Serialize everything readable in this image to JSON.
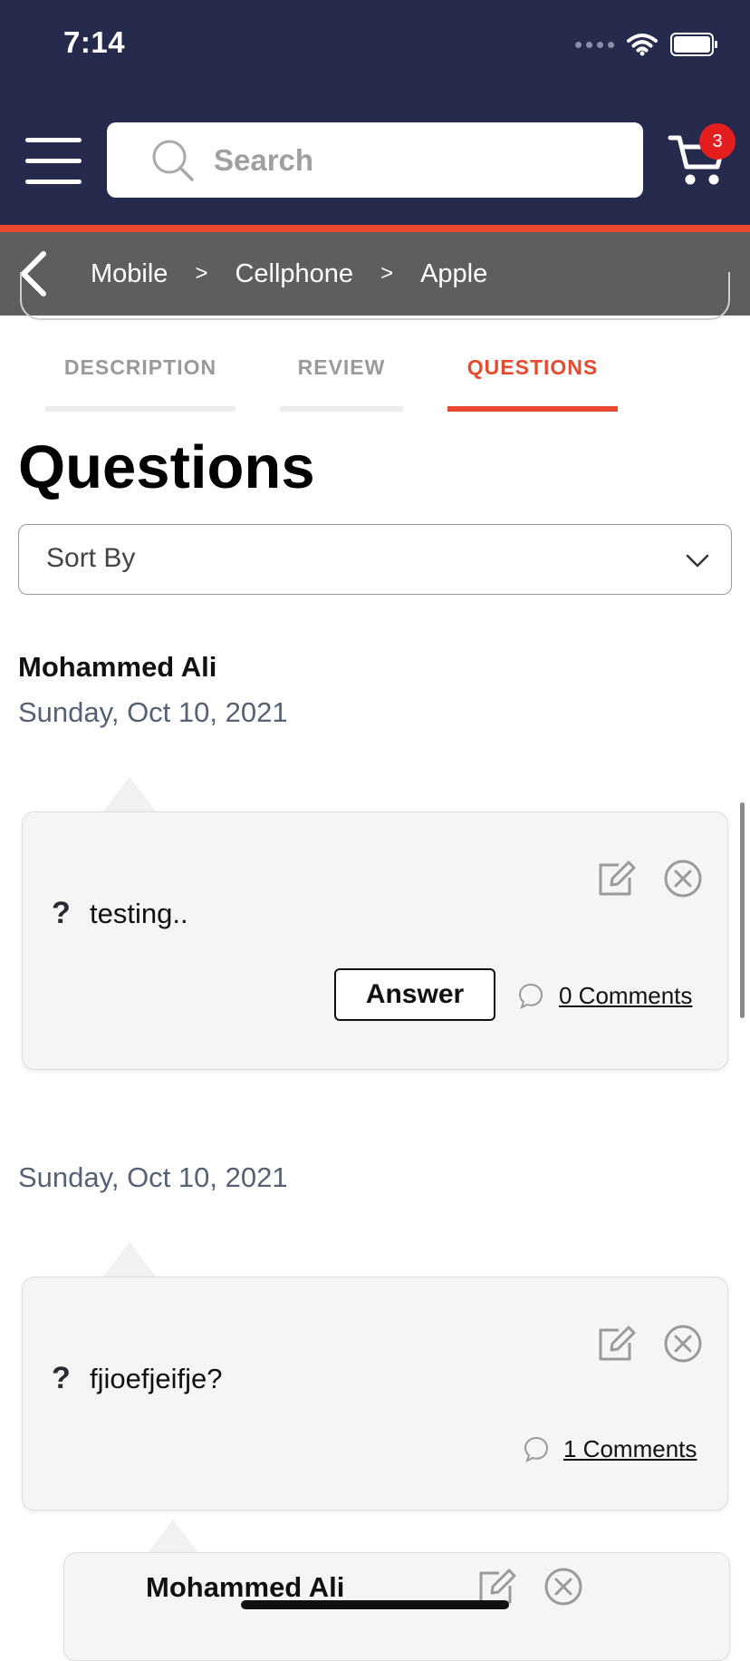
{
  "status": {
    "time": "7:14"
  },
  "header": {
    "search_placeholder": "Search",
    "cart_count": "3"
  },
  "breadcrumb": [
    "Mobile",
    "Cellphone",
    "Apple"
  ],
  "breadcrumb_separator": ">",
  "tabs": [
    {
      "label": "DESCRIPTION",
      "active": false
    },
    {
      "label": "REVIEW",
      "active": false
    },
    {
      "label": "QUESTIONS",
      "active": true
    }
  ],
  "colors": {
    "header_bg": "#262a4d",
    "accent": "#e8492f",
    "breadcrumb_bg": "#5e5e5e",
    "tab_inactive": "#9a9a9a",
    "date": "#566273"
  },
  "section_title": "Questions",
  "sort": {
    "label": "Sort By"
  },
  "questions": [
    {
      "author": "Mohammed Ali",
      "date": "Sunday, Oct 10, 2021",
      "text": "testing..",
      "answer_label": "Answer",
      "comments_label": "0 Comments"
    },
    {
      "author": "",
      "date": "Sunday, Oct 10, 2021",
      "text": "fjioefjeifje?",
      "comments_label": "1 Comments"
    }
  ],
  "reply": {
    "author": "Mohammed Ali"
  },
  "icons": [
    "hamburger-icon",
    "search-icon",
    "cart-icon",
    "back-chevron-icon",
    "chevron-down-icon",
    "edit-icon",
    "close-icon",
    "question-icon",
    "comment-icon"
  ]
}
